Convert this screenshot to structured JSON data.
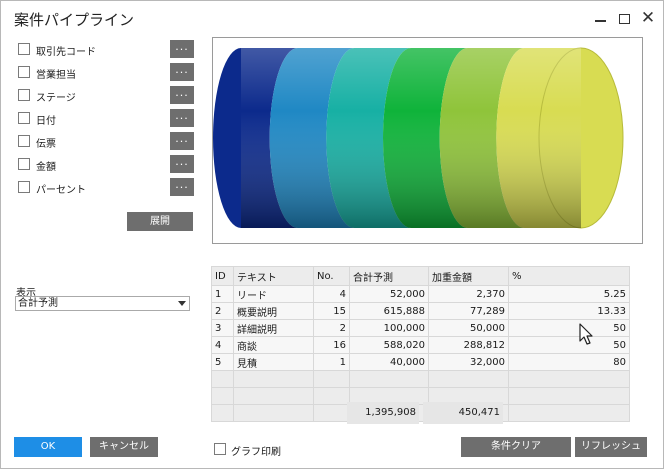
{
  "window": {
    "title": "案件パイプライン"
  },
  "criteria": {
    "items": [
      {
        "label": "取引先コード",
        "checked": false,
        "button": "..."
      },
      {
        "label": "営業担当",
        "checked": false,
        "button": "..."
      },
      {
        "label": "ステージ",
        "checked": false,
        "button": "..."
      },
      {
        "label": "日付",
        "checked": false,
        "button": "..."
      },
      {
        "label": "伝票",
        "checked": false,
        "button": "..."
      },
      {
        "label": "金額",
        "checked": false,
        "button": "..."
      },
      {
        "label": "パーセント",
        "checked": false,
        "button": "..."
      }
    ],
    "expand_label": "展開"
  },
  "display": {
    "label": "表示",
    "selected": "合計予測"
  },
  "funnel_colors": [
    "#0c2a8c",
    "#1f88c4",
    "#17b0a4",
    "#0fb33a",
    "#8fc43a",
    "#d8dc52"
  ],
  "grid": {
    "columns": [
      "ID",
      "テキスト",
      "No.",
      "合計予測",
      "加重金額",
      "%"
    ],
    "rows": [
      [
        "1",
        "リード",
        "4",
        "52,000",
        "2,370",
        "5.25"
      ],
      [
        "2",
        "概要説明",
        "15",
        "615,888",
        "77,289",
        "13.33"
      ],
      [
        "3",
        "詳細説明",
        "2",
        "100,000",
        "50,000",
        "50"
      ],
      [
        "4",
        "商談",
        "16",
        "588,020",
        "288,812",
        "50"
      ],
      [
        "5",
        "見積",
        "1",
        "40,000",
        "32,000",
        "80"
      ]
    ],
    "empty_rows": 3,
    "totals": {
      "total_forecast": "1,395,908",
      "weighted_amount": "450,471"
    }
  },
  "footer": {
    "ok_label": "OK",
    "cancel_label": "キャンセル",
    "print_graph_label": "グラフ印刷",
    "print_graph_checked": false,
    "clear_criteria_label": "条件クリア",
    "refresh_label": "リフレッシュ"
  }
}
